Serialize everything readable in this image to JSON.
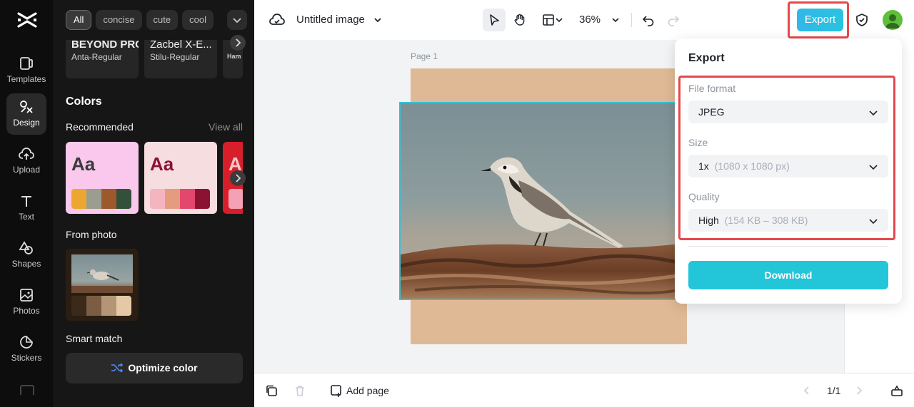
{
  "rail": {
    "items": [
      {
        "label": "Templates"
      },
      {
        "label": "Design"
      },
      {
        "label": "Upload"
      },
      {
        "label": "Text"
      },
      {
        "label": "Shapes"
      },
      {
        "label": "Photos"
      },
      {
        "label": "Stickers"
      }
    ]
  },
  "panel": {
    "chips": [
      "All",
      "concise",
      "cute",
      "cool"
    ],
    "fonts": [
      {
        "preview": "BEYOND PRO...",
        "name": "Anta-Regular"
      },
      {
        "preview": "Zacbel X-E...",
        "name": "Stilu-Regular"
      },
      {
        "preview": "Ham",
        "name": ""
      }
    ],
    "colors_title": "Colors",
    "recommended_label": "Recommended",
    "view_all": "View all",
    "palettes": [
      {
        "aa": "Aa",
        "bg": "#f9c8ec",
        "text_color": "#3a3a3a",
        "swatches": [
          "#eda62f",
          "#9a9d90",
          "#9c5a2c",
          "#33503a"
        ]
      },
      {
        "aa": "Aa",
        "bg": "#f6dde0",
        "text_color": "#8c1232",
        "swatches": [
          "#f4b5c0",
          "#e59b7e",
          "#e4476d",
          "#8c1232"
        ]
      },
      {
        "aa": "A",
        "bg": "#d71f2b",
        "text_color": "#f6c6cb",
        "swatches": [
          "#f4a1b6",
          "#f4a1b6",
          "#f4a1b6",
          "#f4a1b6"
        ]
      }
    ],
    "from_photo_label": "From photo",
    "photo_swatches": [
      "#3b2a19",
      "#7a5d43",
      "#b49677",
      "#e5c9a7"
    ],
    "smart_match_label": "Smart match",
    "optimize_label": "Optimize color"
  },
  "topbar": {
    "title": "Untitled image",
    "zoom": "36%",
    "export_label": "Export"
  },
  "canvas": {
    "page_label": "Page 1"
  },
  "bottombar": {
    "add_page_label": "Add page",
    "pager": "1/1"
  },
  "export_popup": {
    "title": "Export",
    "file_format_label": "File format",
    "file_format_value": "JPEG",
    "size_label": "Size",
    "size_value": "1x",
    "size_detail": "(1080 x 1080 px)",
    "quality_label": "Quality",
    "quality_value": "High",
    "quality_detail": "(154 KB – 308 KB)",
    "download_label": "Download"
  },
  "colors": {
    "accent": "#23c5d9",
    "highlight": "#e5484d"
  }
}
